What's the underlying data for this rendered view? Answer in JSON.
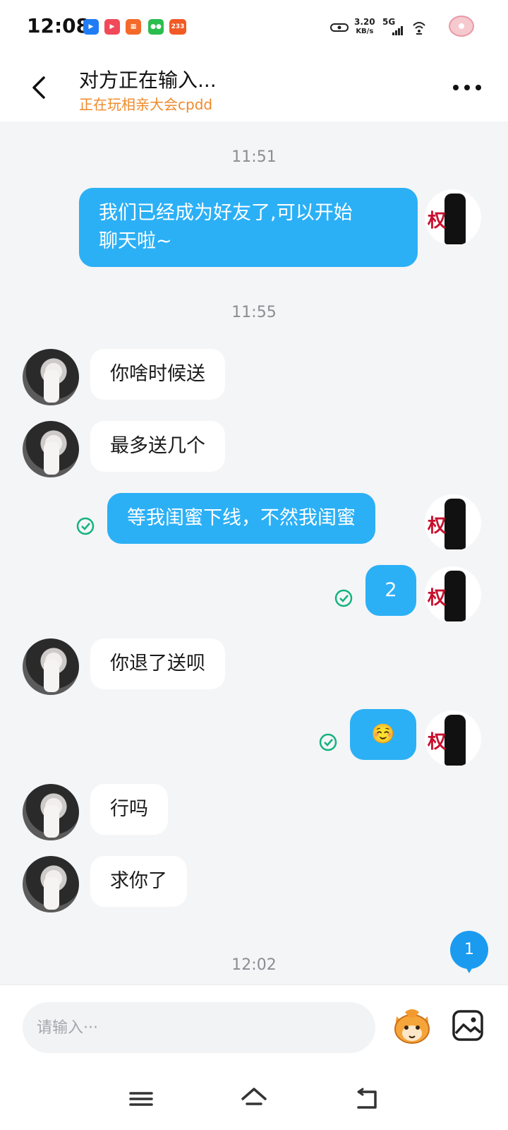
{
  "status_bar": {
    "time": "12:08",
    "notifications": [
      {
        "name": "video-call-icon",
        "color": "#1f7cf5",
        "label": ""
      },
      {
        "name": "video-app-icon",
        "color": "#f04a5a",
        "label": ""
      },
      {
        "name": "app-grid-icon",
        "color": "#f36a2a",
        "label": ""
      },
      {
        "name": "wechat-icon",
        "color": "#2bbd4e",
        "label": ""
      },
      {
        "name": "game-233-icon",
        "color": "#f15a24",
        "label": "233"
      }
    ],
    "net_speed_value": "3.20",
    "net_speed_unit": "KB/s",
    "network": "5G"
  },
  "header": {
    "title": "对方正在输入...",
    "subtitle": "正在玩相亲大会cpdd"
  },
  "messages": [
    {
      "type": "timestamp",
      "text": "11:51"
    },
    {
      "type": "out",
      "text_line1": "我们已经成为好友了,可以开始",
      "text_line2": "聊天啦~"
    },
    {
      "type": "timestamp",
      "text": "11:55"
    },
    {
      "type": "in",
      "text": "你啥时候送"
    },
    {
      "type": "in",
      "text": "最多送几个"
    },
    {
      "type": "out",
      "text": "等我闺蜜下线，不然我闺蜜",
      "read": true
    },
    {
      "type": "out",
      "text": "2",
      "read": true
    },
    {
      "type": "in",
      "text": "你退了送呗"
    },
    {
      "type": "out",
      "text": "☺️",
      "read": true
    },
    {
      "type": "in",
      "text": "行吗"
    },
    {
      "type": "in",
      "text": "求你了"
    },
    {
      "type": "timestamp",
      "text": "12:02"
    }
  ],
  "self_avatar_glyph": "权",
  "unread_count": "1",
  "input": {
    "placeholder": "请输入···"
  },
  "nav": {
    "buttons": [
      "menu-icon",
      "home-icon",
      "back-icon"
    ]
  }
}
